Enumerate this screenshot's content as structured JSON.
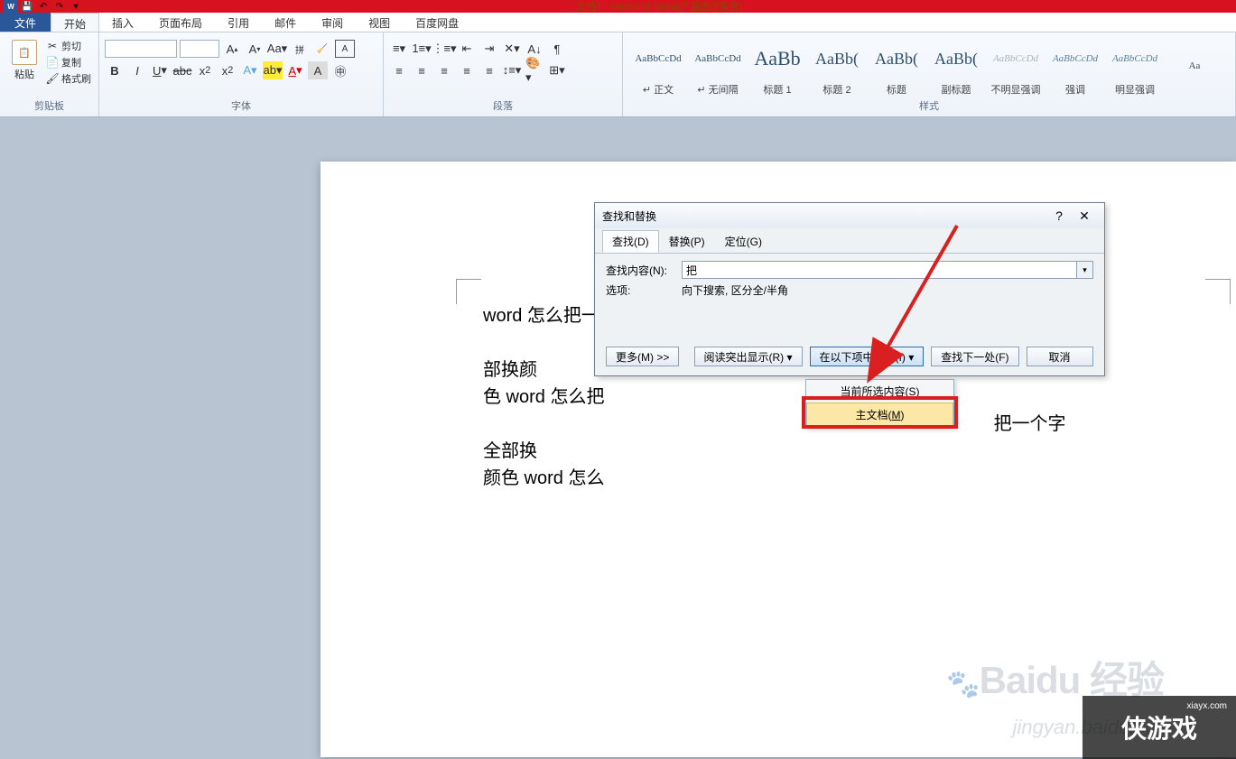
{
  "titlebar": {
    "title": "文档1 - Microsoft Word(产品激活失败)"
  },
  "tabs": {
    "file": "文件",
    "home": "开始",
    "insert": "插入",
    "layout": "页面布局",
    "ref": "引用",
    "mail": "邮件",
    "review": "审阅",
    "view": "视图",
    "baidu": "百度网盘"
  },
  "clipboard": {
    "paste": "粘贴",
    "cut": "剪切",
    "copy": "复制",
    "fmtpainter": "格式刷",
    "group": "剪贴板"
  },
  "font": {
    "group": "字体"
  },
  "para": {
    "group": "段落"
  },
  "styles": {
    "group": "样式",
    "items": [
      {
        "preview": "AaBbCcDd",
        "name": "↵ 正文",
        "size": "11px"
      },
      {
        "preview": "AaBbCcDd",
        "name": "↵ 无间隔",
        "size": "11px"
      },
      {
        "preview": "AaBb",
        "name": "标题 1",
        "size": "22px"
      },
      {
        "preview": "AaBb(",
        "name": "标题 2",
        "size": "18px"
      },
      {
        "preview": "AaBb(",
        "name": "标题",
        "size": "18px"
      },
      {
        "preview": "AaBb(",
        "name": "副标题",
        "size": "18px"
      },
      {
        "preview": "AaBbCcDd",
        "name": "不明显强调",
        "size": "11px",
        "color": "#a8b3bb",
        "italic": true
      },
      {
        "preview": "AaBbCcDd",
        "name": "强调",
        "size": "11px",
        "color": "#5682a3",
        "italic": true
      },
      {
        "preview": "AaBbCcDd",
        "name": "明显强调",
        "size": "11px",
        "color": "#5682a3",
        "italic": true
      },
      {
        "preview": "Aa",
        "name": "",
        "size": "11px"
      }
    ]
  },
  "document": {
    "line1": "word 怎么把一",
    "line1b": "一个字全部换颜",
    "line2": "色 word 怎么把",
    "line2b": "把一个字全部换",
    "line3": "颜色 word 怎么"
  },
  "dialog": {
    "title": "查找和替换",
    "help": "?",
    "tabs": {
      "find": "查找(D)",
      "replace": "替换(P)",
      "goto": "定位(G)"
    },
    "findLabel": "查找内容(N):",
    "findValue": "把",
    "optLabel": "选项:",
    "optValue": "向下搜索, 区分全/半角",
    "buttons": {
      "more": "更多(M) >>",
      "highlight": "阅读突出显示(R) ▾",
      "findin": "在以下项中查找(I) ▾",
      "findnext": "查找下一处(F)",
      "cancel": "取消"
    },
    "menu": {
      "sel": "当前所选内容(S)",
      "main": "主文档(M)"
    }
  },
  "watermark": {
    "baidu": "Baidu 经验",
    "url": "jingyan.baidu.com",
    "site": "侠游戏",
    "siteurl": "xiayx.com"
  }
}
